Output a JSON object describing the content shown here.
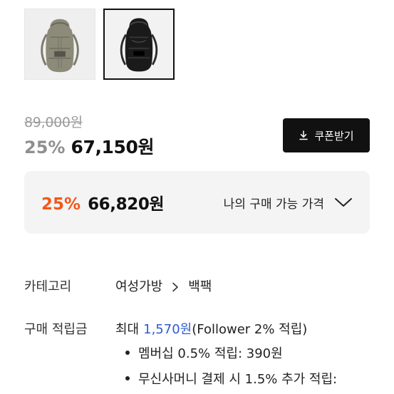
{
  "thumbnails": [
    {
      "name": "khaki-backpack",
      "color": "#8c8a78",
      "selected": false
    },
    {
      "name": "black-backpack",
      "color": "#1a1a1a",
      "selected": true
    }
  ],
  "price": {
    "original": "89,000원",
    "sale_rate": "25%",
    "sale_price": "67,150원"
  },
  "coupon": {
    "label": "쿠폰받기",
    "icon": "download-icon"
  },
  "my_price": {
    "rate": "25%",
    "price": "66,820원",
    "label": "나의 구매 가능 가격",
    "icon": "chevron-down-icon",
    "accent": "#f3571b"
  },
  "category": {
    "key": "카테고리",
    "parent": "여성가방",
    "child": "백팩"
  },
  "points": {
    "key": "구매 적립금",
    "prefix": "최대",
    "amount": "1,570원",
    "suffix": "(Follower 2% 적립)",
    "bullets": [
      "멤버십 0.5% 적립: 390원",
      "무신사머니 결제 시 1.5% 추가 적립:"
    ]
  }
}
